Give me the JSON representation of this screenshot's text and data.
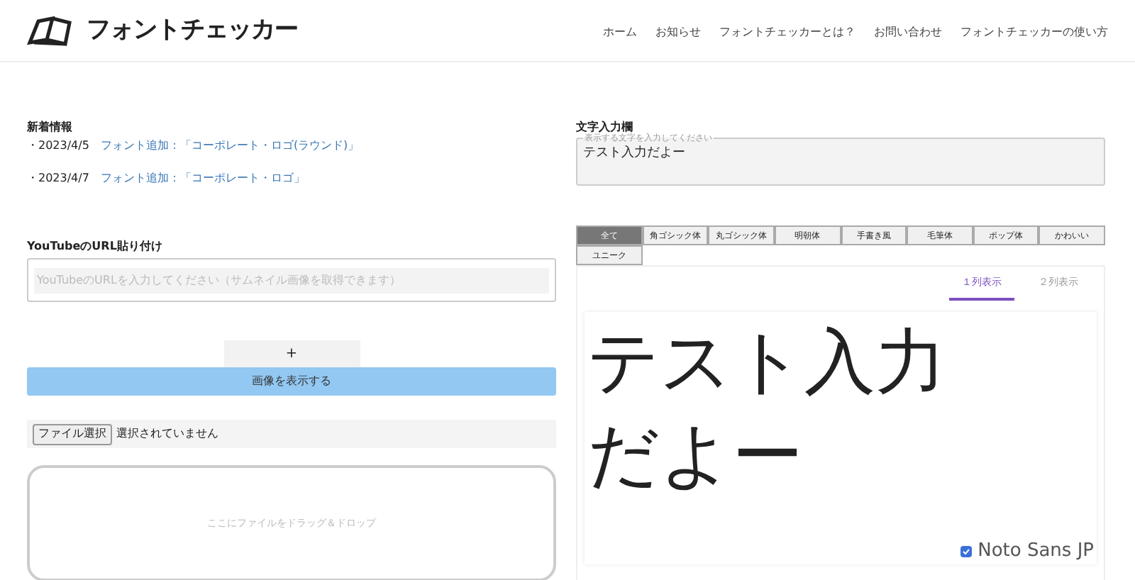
{
  "header": {
    "logo_text": "フォントチェッカー",
    "nav": [
      "ホーム",
      "お知らせ",
      "フォントチェッカーとは？",
      "お問い合わせ",
      "フォントチェッカーの使い方"
    ]
  },
  "news": {
    "title": "新着情報",
    "items": [
      {
        "date": "・2023/4/5",
        "link": "フォント追加：「コーポレート・ロゴ(ラウンド)」"
      },
      {
        "date": "・2023/4/7",
        "link": "フォント追加：「コーポレート・ロゴ」"
      }
    ]
  },
  "youtube": {
    "label": "YouTubeのURL貼り付け",
    "placeholder": "YouTubeのURLを入力してください（サムネイル画像を取得できます）"
  },
  "add_button": "+",
  "show_button": "画像を表示する",
  "file": {
    "button": "ファイル選択",
    "status": "選択されていません",
    "drop_text": "ここにファイルをドラッグ＆ドロップ"
  },
  "text_input": {
    "label": "文字入力欄",
    "legend": "表示する文字を入力してください",
    "value": "テスト入力だよー"
  },
  "categories": [
    {
      "label": "全て",
      "selected": true
    },
    {
      "label": "角ゴシック体",
      "selected": false
    },
    {
      "label": "丸ゴシック体",
      "selected": false
    },
    {
      "label": "明朝体",
      "selected": false
    },
    {
      "label": "手書き風",
      "selected": false
    },
    {
      "label": "毛筆体",
      "selected": false
    },
    {
      "label": "ポップ体",
      "selected": false
    },
    {
      "label": "かわいい",
      "selected": false
    },
    {
      "label": "ユニーク",
      "selected": false
    }
  ],
  "view_tabs": [
    {
      "label": "１列表示",
      "selected": true
    },
    {
      "label": "２列表示",
      "selected": false
    }
  ],
  "preview": {
    "text": "テスト入力だよー",
    "font_name": "Noto Sans JP",
    "checked": true
  }
}
